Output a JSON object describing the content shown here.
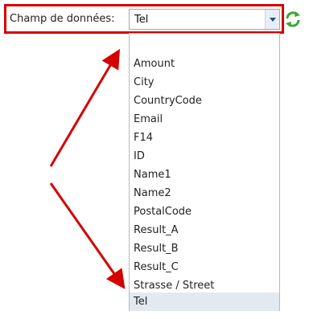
{
  "field": {
    "label": "Champ de données:",
    "value": "Tel"
  },
  "dropdown": {
    "options": [
      "",
      "Amount",
      "City",
      "CountryCode",
      "Email",
      "F14",
      "ID",
      "Name1",
      "Name2",
      "PostalCode",
      "Result_A",
      "Result_B",
      "Result_C",
      "Strasse / Street",
      "Tel"
    ],
    "selected": "Tel"
  },
  "colors": {
    "annotation_red": "#d50000",
    "selection_bg": "#e3e9f1",
    "refresh_green": "#3aa63a"
  },
  "icons": {
    "refresh": "refresh-icon",
    "dropdown_arrow": "chevron-down-icon"
  }
}
